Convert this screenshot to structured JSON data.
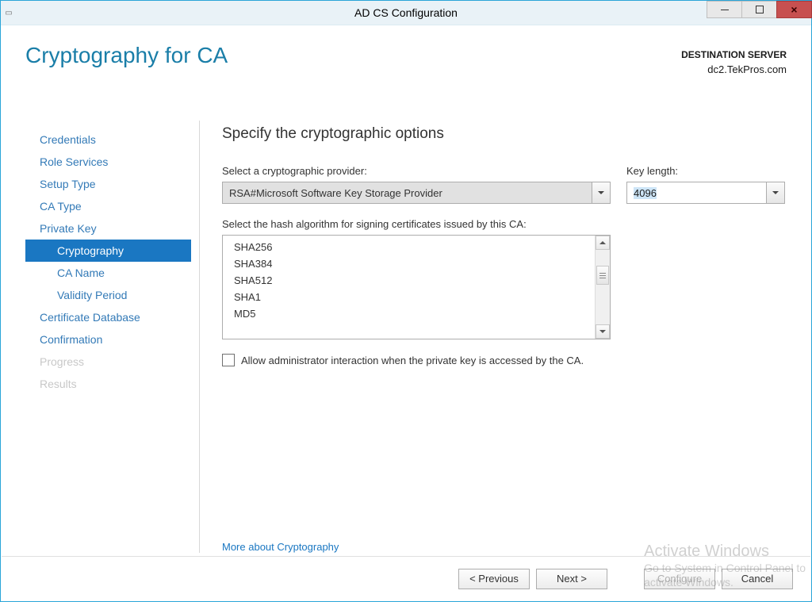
{
  "window": {
    "title": "AD CS Configuration"
  },
  "header": {
    "page_title": "Cryptography for CA",
    "destination_label": "DESTINATION SERVER",
    "destination_value": "dc2.TekPros.com"
  },
  "sidebar": {
    "items": [
      {
        "label": "Credentials",
        "sub": false,
        "selected": false,
        "disabled": false
      },
      {
        "label": "Role Services",
        "sub": false,
        "selected": false,
        "disabled": false
      },
      {
        "label": "Setup Type",
        "sub": false,
        "selected": false,
        "disabled": false
      },
      {
        "label": "CA Type",
        "sub": false,
        "selected": false,
        "disabled": false
      },
      {
        "label": "Private Key",
        "sub": false,
        "selected": false,
        "disabled": false
      },
      {
        "label": "Cryptography",
        "sub": true,
        "selected": true,
        "disabled": false
      },
      {
        "label": "CA Name",
        "sub": true,
        "selected": false,
        "disabled": false
      },
      {
        "label": "Validity Period",
        "sub": true,
        "selected": false,
        "disabled": false
      },
      {
        "label": "Certificate Database",
        "sub": false,
        "selected": false,
        "disabled": false
      },
      {
        "label": "Confirmation",
        "sub": false,
        "selected": false,
        "disabled": false
      },
      {
        "label": "Progress",
        "sub": false,
        "selected": false,
        "disabled": true
      },
      {
        "label": "Results",
        "sub": false,
        "selected": false,
        "disabled": true
      }
    ]
  },
  "main": {
    "section_title": "Specify the cryptographic options",
    "provider_label": "Select a cryptographic provider:",
    "provider_value": "RSA#Microsoft Software Key Storage Provider",
    "keylength_label": "Key length:",
    "keylength_value": "4096",
    "hash_label": "Select the hash algorithm for signing certificates issued by this CA:",
    "hash_options": [
      "SHA256",
      "SHA384",
      "SHA512",
      "SHA1",
      "MD5"
    ],
    "checkbox_label": "Allow administrator interaction when the private key is accessed by the CA.",
    "checkbox_checked": false,
    "more_link": "More about Cryptography"
  },
  "footer": {
    "previous": "< Previous",
    "next": "Next >",
    "configure": "Configure",
    "cancel": "Cancel"
  },
  "watermark": {
    "line1": "Activate Windows",
    "line2": "Go to System in Control Panel to",
    "line3": "activate Windows."
  }
}
